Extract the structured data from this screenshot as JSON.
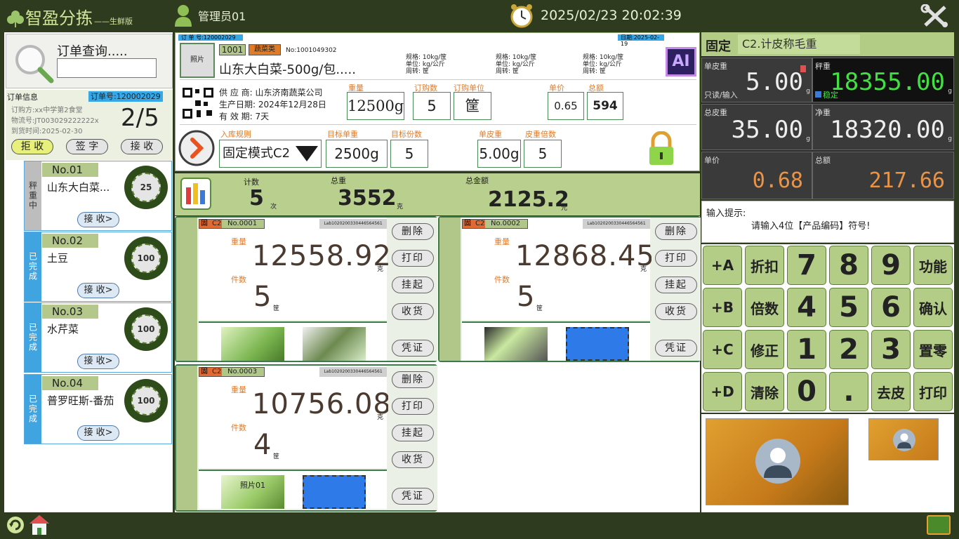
{
  "brand": {
    "name": "智盈分拣",
    "sub": "——生鲜版"
  },
  "user": {
    "name": "管理员01"
  },
  "datetime": "2025/02/23 20:02:39",
  "search": {
    "title": "订单查询....."
  },
  "order": {
    "label": "订单信息",
    "order_no": "订单号:120002029",
    "buyer": "订购方:xx中学第2食堂",
    "logistics": "物流号:JT003029222222x",
    "arrive": "到货时间:2025-02-30",
    "progress": "2/5",
    "btn_reject": "拒 收",
    "btn_sign": "签 字",
    "btn_accept": "接 收"
  },
  "items": [
    {
      "no": "No.01",
      "name": "山东大白菜...",
      "status": "秤重中",
      "ring": "25",
      "btn": "接 收>"
    },
    {
      "no": "No.02",
      "name": "土豆",
      "status": "已完成",
      "ring": "100",
      "btn": "接 收>"
    },
    {
      "no": "No.03",
      "name": "水芹菜",
      "status": "已完成",
      "ring": "100",
      "btn": "接 收>"
    },
    {
      "no": "No.04",
      "name": "普罗旺斯-番茄",
      "status": "已完成",
      "ring": "100",
      "btn": "接 收>"
    }
  ],
  "product": {
    "order_bar": "订 单 号:120002029",
    "date_bar": "日期:2025-02-19",
    "photo": "照片",
    "code": "1001",
    "category": "蔬菜类",
    "pid": "No:1001049302",
    "name": "山东大白菜-500g/包.....",
    "specs": [
      {
        "a": "规格: 10kg/筐",
        "b": "单位:   kg/公斤",
        "c": "周转:     筐"
      },
      {
        "a": "规格: 10kg/筐",
        "b": "单位:   kg/公斤",
        "c": "周转:     筐"
      },
      {
        "a": "规格: 10kg/筐",
        "b": "单位:   kg/公斤",
        "c": "周转:     筐"
      }
    ],
    "ai": "AI",
    "supplier": "供 应 商:  山东济南蔬菜公司",
    "prod_date": "生产日期:  2024年12月28日",
    "valid": "有 效 期:  7天",
    "weight_lbl": "重量",
    "weight": "12500g",
    "qty_lbl": "订购数",
    "qty": "5",
    "unit_lbl": "订购单位",
    "unit": "筐",
    "price_lbl": "单价",
    "price": "0.65",
    "amount_lbl": "总额",
    "amount": "594",
    "rule_lbl": "入库规则",
    "rule": "固定模式C2",
    "tw_lbl": "目标单重",
    "tw": "2500g",
    "tn_lbl": "目标份数",
    "tn": "5",
    "tare_lbl": "单皮重",
    "tare": "5.00g",
    "tm_lbl": "皮重倍数",
    "tm": "5"
  },
  "summary": {
    "count_lbl": "计数",
    "count": "5",
    "count_unit": "次",
    "total_lbl": "总重",
    "total": "3552",
    "total_unit": "克",
    "money_lbl": "总金额",
    "money": "2125.2",
    "money_unit": "元"
  },
  "cards": [
    {
      "tag": "固",
      "mode": "C2",
      "no": "No.0001",
      "lab": "Lab1020200330446564561",
      "w_lbl": "重量",
      "weight": "12558.92",
      "w_unit": "克",
      "n_lbl": "件数",
      "pieces": "5",
      "p_unit": "筐",
      "photo_caption": ""
    },
    {
      "tag": "固",
      "mode": "C2",
      "no": "No.0002",
      "lab": "Lab1020200330446564561",
      "w_lbl": "重量",
      "weight": "12868.45",
      "w_unit": "克",
      "n_lbl": "件数",
      "pieces": "5",
      "p_unit": "筐",
      "photo_caption": ""
    },
    {
      "tag": "固",
      "mode": "C2",
      "no": "No.0003",
      "lab": "Lab1020200330446564561",
      "w_lbl": "重量",
      "weight": "10756.08",
      "w_unit": "克",
      "n_lbl": "件数",
      "pieces": "4",
      "p_unit": "筐",
      "photo_caption": "照片01"
    }
  ],
  "card_buttons": {
    "del": "删除",
    "print": "打印",
    "hold": "挂起",
    "receive": "收货",
    "voucher": "凭证"
  },
  "scale": {
    "mode": "固定",
    "mode_desc": "C2.计皮称毛重",
    "tare_lbl": "单皮重",
    "tare": "5.00",
    "tare_note": "只读/输入",
    "weigh_lbl": "秤重",
    "weigh": "18355.00",
    "stable": "稳定",
    "ttare_lbl": "总皮重",
    "ttare": "35.00",
    "net_lbl": "净重",
    "net": "18320.00",
    "uprice_lbl": "单价",
    "uprice": "0.68",
    "total_lbl": "总额",
    "total": "217.66",
    "unit_g": "g"
  },
  "tip": {
    "title": "输入提示:",
    "msg": "请输入4位【产品编码】符号!"
  },
  "keys": [
    "+A",
    "折扣",
    "7",
    "8",
    "9",
    "功能",
    "+B",
    "倍数",
    "4",
    "5",
    "6",
    "确认",
    "+C",
    "修正",
    "1",
    "2",
    "3",
    "置零",
    "+D",
    "清除",
    "0",
    ".",
    "去皮",
    "打印"
  ],
  "colors": {
    "bg": "#2e3b1e",
    "accent": "#b3cc86",
    "green_value": "#43e043",
    "orange_value": "#e89448"
  }
}
